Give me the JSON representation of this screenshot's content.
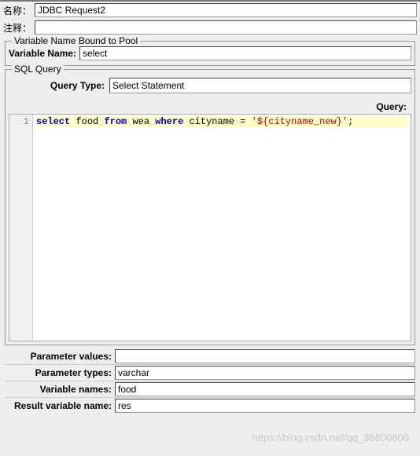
{
  "top": {
    "name_label": "名称：",
    "name_value": "JDBC Request2",
    "comment_label": "注释："
  },
  "pool": {
    "legend": "Variable Name Bound to Pool",
    "var_label": "Variable Name:",
    "var_value": "select"
  },
  "sql": {
    "legend": "SQL Query",
    "query_type_label": "Query Type:",
    "query_type_value": "Select Statement",
    "query_label": "Query:",
    "gutter_line": "1",
    "code": {
      "kw1": "select",
      "t1": " food ",
      "kw2": "from",
      "t2": " wea ",
      "kw3": "where",
      "t3": " cityname = ",
      "str": "'${cityname_new}'",
      "t4": ";"
    }
  },
  "params": {
    "param_values_label": "Parameter values:",
    "param_values_value": "",
    "param_types_label": "Parameter types:",
    "param_types_value": "varchar",
    "var_names_label": "Variable names:",
    "var_names_value": "food",
    "result_var_label": "Result variable name:",
    "result_var_value": "res"
  },
  "watermark": "https://blog.csdn.net/qq_36800800"
}
